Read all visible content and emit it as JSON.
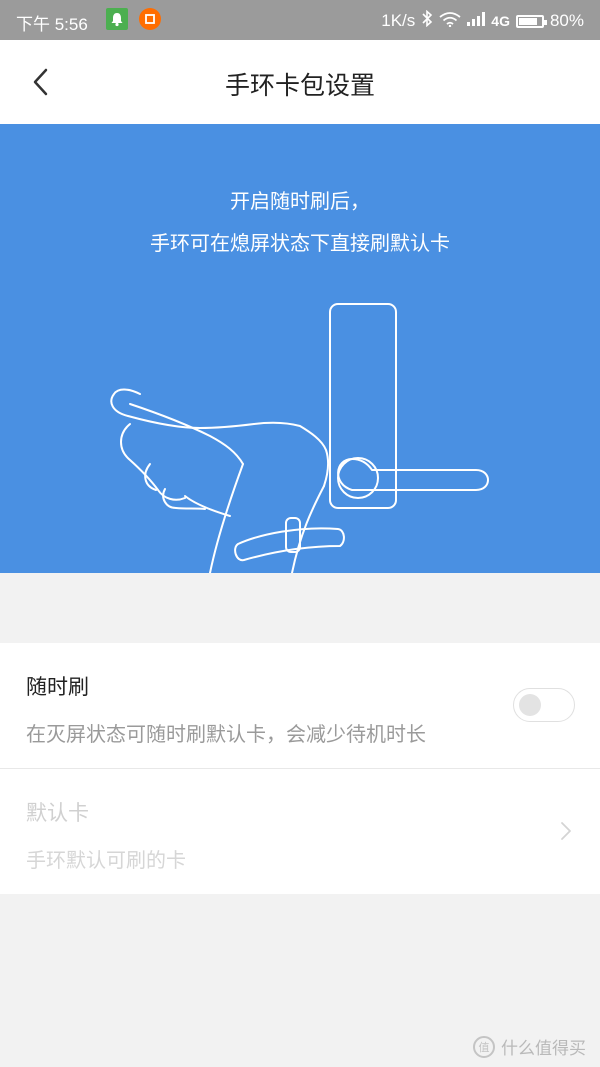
{
  "status_bar": {
    "time": "下午 5:56",
    "network_speed": "1K/s",
    "network_type": "4G",
    "battery_text": "80%",
    "battery_level": 0.8
  },
  "header": {
    "title": "手环卡包设置",
    "back_icon": "chevron-left-icon"
  },
  "banner": {
    "line1": "开启随时刷后，",
    "line2": "手环可在熄屏状态下直接刷默认卡",
    "background_color": "#4a90e2"
  },
  "settings": {
    "items": [
      {
        "title": "随时刷",
        "subtitle": "在灭屏状态可随时刷默认卡，会减少待机时长",
        "toggle_on": false
      },
      {
        "title": "默认卡",
        "subtitle": "手环默认可刷的卡",
        "disabled": true
      }
    ]
  },
  "watermark": {
    "logo_text": "值",
    "text": "什么值得买"
  }
}
